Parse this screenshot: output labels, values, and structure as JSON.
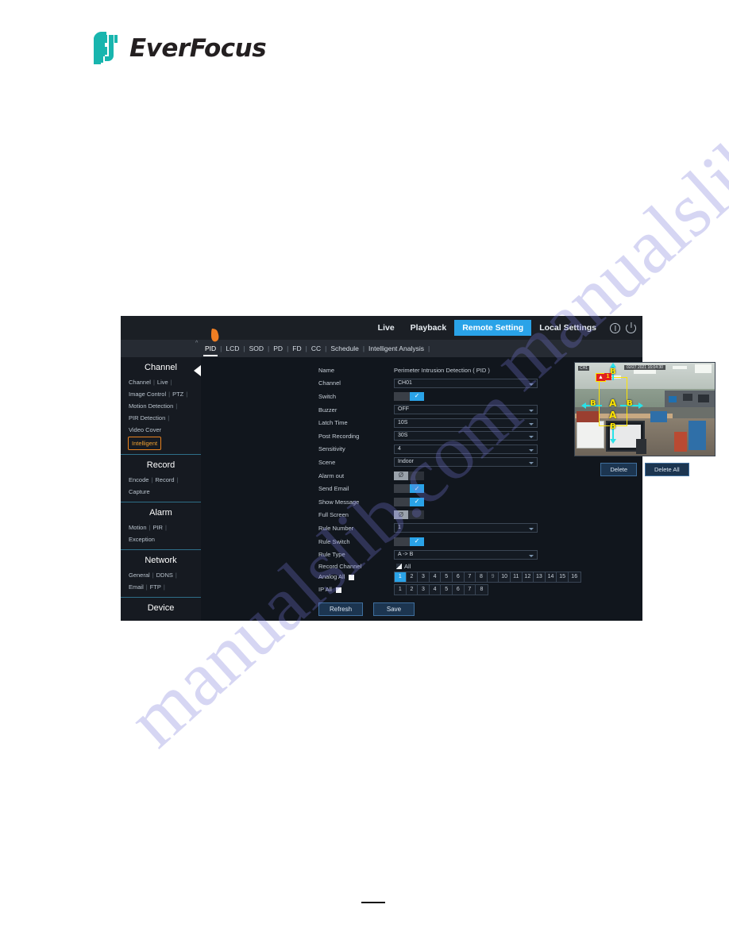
{
  "brand": {
    "name": "EverFocus"
  },
  "watermark": {
    "line1": "manualslib.com",
    "line2": "manualslib.com"
  },
  "colors": {
    "accent": "#2aa3e8",
    "panel_bg": "#11161d",
    "sidebar_bg": "#161a21",
    "topbar_bg": "#1b1f25",
    "tabrow_bg": "#262b33",
    "divider": "#2e6f88",
    "highlight_border": "#e8821e",
    "highlight_text": "#f0a030",
    "rule_yellow": "#ffe400",
    "arrow_cyan": "#29e2e8",
    "alarm_red": "#e02020"
  },
  "topbar": {
    "items": [
      {
        "label": "Live",
        "active": false
      },
      {
        "label": "Playback",
        "active": false
      },
      {
        "label": "Remote Setting",
        "active": true
      },
      {
        "label": "Local Settings",
        "active": false
      }
    ],
    "icons": [
      {
        "name": "info-icon"
      },
      {
        "name": "power-icon"
      }
    ]
  },
  "tabs": [
    {
      "label": "PID",
      "active": true
    },
    {
      "label": "LCD",
      "active": false
    },
    {
      "label": "SOD",
      "active": false
    },
    {
      "label": "PD",
      "active": false
    },
    {
      "label": "FD",
      "active": false
    },
    {
      "label": "CC",
      "active": false
    },
    {
      "label": "Schedule",
      "active": false
    },
    {
      "label": "Intelligent Analysis",
      "active": false
    }
  ],
  "sidebar": {
    "groups": [
      {
        "title": "Channel",
        "links": [
          {
            "label": "Channel",
            "selected": false
          },
          {
            "label": "Live",
            "selected": false
          },
          {
            "label": "Image Control",
            "selected": false
          },
          {
            "label": "PTZ",
            "selected": false
          },
          {
            "label": "Motion Detection",
            "selected": false
          },
          {
            "label": "PIR Detection",
            "selected": false
          },
          {
            "label": "Video Cover",
            "selected": false
          },
          {
            "label": "Intelligent",
            "selected": true
          }
        ]
      },
      {
        "title": "Record",
        "links": [
          {
            "label": "Encode",
            "selected": false
          },
          {
            "label": "Record",
            "selected": false
          },
          {
            "label": "Capture",
            "selected": false
          }
        ]
      },
      {
        "title": "Alarm",
        "links": [
          {
            "label": "Motion",
            "selected": false
          },
          {
            "label": "PIR",
            "selected": false
          },
          {
            "label": "Exception",
            "selected": false
          }
        ]
      },
      {
        "title": "Network",
        "links": [
          {
            "label": "General",
            "selected": false
          },
          {
            "label": "DDNS",
            "selected": false
          },
          {
            "label": "Email",
            "selected": false
          },
          {
            "label": "FTP",
            "selected": false
          }
        ]
      },
      {
        "title": "Device",
        "links": []
      }
    ]
  },
  "form": {
    "name_label": "Name",
    "name_value": "Perimeter Intrusion Detection  ( PID )",
    "fields": [
      {
        "label": "Channel",
        "type": "select",
        "value": "CH01"
      },
      {
        "label": "Switch",
        "type": "toggle",
        "value": "on"
      },
      {
        "label": "Buzzer",
        "type": "select",
        "value": "OFF"
      },
      {
        "label": "Latch Time",
        "type": "select",
        "value": "10S"
      },
      {
        "label": "Post Recording",
        "type": "select",
        "value": "30S"
      },
      {
        "label": "Sensitivity",
        "type": "select",
        "value": "4"
      },
      {
        "label": "Scene",
        "type": "select",
        "value": "Indoor"
      },
      {
        "label": "Alarm out",
        "type": "toggle",
        "value": "off"
      },
      {
        "label": "Send Email",
        "type": "toggle",
        "value": "on"
      },
      {
        "label": "Show Message",
        "type": "toggle",
        "value": "on"
      },
      {
        "label": "Full Screen",
        "type": "toggle",
        "value": "off"
      },
      {
        "label": "Rule Number",
        "type": "select",
        "value": "1"
      },
      {
        "label": "Rule Switch",
        "type": "toggle",
        "value": "on"
      },
      {
        "label": "Rule Type",
        "type": "select",
        "value": "A -> B"
      }
    ],
    "record_channel": {
      "label": "Record Channel",
      "all_label": "All",
      "analog": {
        "label": "Analog All",
        "channels": [
          "1",
          "2",
          "3",
          "4",
          "5",
          "6",
          "7",
          "8",
          "9",
          "10",
          "11",
          "12",
          "13",
          "14",
          "15",
          "16"
        ],
        "selected": [
          "1"
        ],
        "dim": [
          "9"
        ]
      },
      "ip": {
        "label": "IP All",
        "channels": [
          "1",
          "2",
          "3",
          "4",
          "5",
          "6",
          "7",
          "8"
        ],
        "selected": []
      }
    },
    "buttons": [
      {
        "label": "Refresh",
        "name": "refresh-button"
      },
      {
        "label": "Save",
        "name": "save-button"
      }
    ]
  },
  "preview": {
    "osd_channel": "CH1",
    "osd_time": "02/27 2021 16:04:30",
    "rule_labels": {
      "top": "B",
      "left": "B",
      "right": "B",
      "bottom": "B",
      "inner_top": "A",
      "inner_bottom": "A",
      "badge": "1"
    },
    "buttons": [
      {
        "label": "Delete",
        "name": "delete-button"
      },
      {
        "label": "Delete All",
        "name": "delete-all-button"
      }
    ]
  }
}
